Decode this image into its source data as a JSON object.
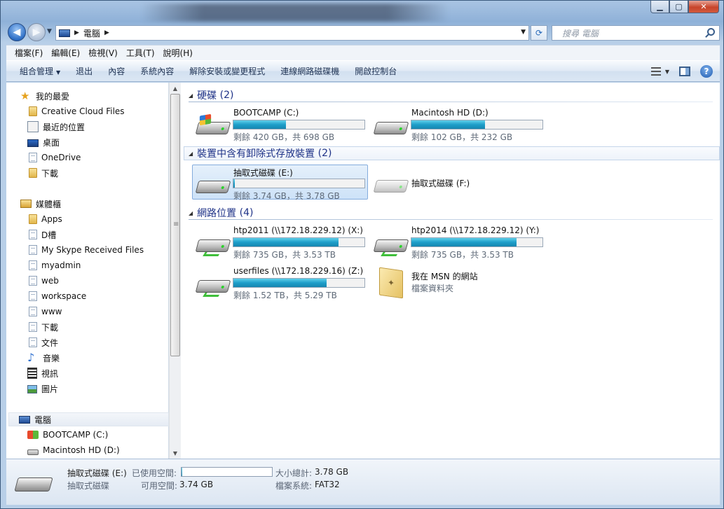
{
  "address": {
    "crumbs": [
      "電腦"
    ],
    "search_placeholder": "搜尋 電腦"
  },
  "menu": [
    "檔案(F)",
    "編輯(E)",
    "檢視(V)",
    "工具(T)",
    "說明(H)"
  ],
  "commands": [
    "組合管理",
    "退出",
    "內容",
    "系統內容",
    "解除安裝或變更程式",
    "連線網路磁碟機",
    "開啟控制台"
  ],
  "nav": {
    "favorites_header": "我的最愛",
    "favorites": [
      "Creative Cloud Files",
      "最近的位置",
      "桌面",
      "OneDrive",
      "下載"
    ],
    "libraries_header": "媒體櫃",
    "libraries": [
      "Apps",
      "D槽",
      "My Skype Received Files",
      "myadmin",
      "web",
      "workspace",
      "www",
      "下載",
      "文件",
      "音樂",
      "視訊",
      "圖片"
    ],
    "computer_header": "電腦",
    "computer": [
      "BOOTCAMP (C:)",
      "Macintosh HD (D:)"
    ]
  },
  "groups": {
    "hdd": {
      "title": "硬碟",
      "count": "(2)"
    },
    "removable": {
      "title": "裝置中含有卸除式存放裝置",
      "count": "(2)"
    },
    "network": {
      "title": "網路位置",
      "count": "(4)"
    }
  },
  "drives": {
    "c": {
      "name": "BOOTCAMP (C:)",
      "space": "剩餘 420 GB，共 698 GB",
      "used_fraction": 0.4
    },
    "d": {
      "name": "Macintosh HD (D:)",
      "space": "剩餘 102 GB，共 232 GB",
      "used_fraction": 0.56
    },
    "e": {
      "name": "抽取式磁碟 (E:)",
      "space": "剩餘 3.74 GB，共 3.78 GB",
      "used_fraction": 0.01
    },
    "f": {
      "name": "抽取式磁碟 (F:)"
    },
    "x": {
      "name": "htp2011 (\\\\172.18.229.12) (X:)",
      "space": "剩餘 735 GB，共 3.53 TB",
      "used_fraction": 0.8
    },
    "y": {
      "name": "htp2014 (\\\\172.18.229.12) (Y:)",
      "space": "剩餘 735 GB，共 3.53 TB",
      "used_fraction": 0.8
    },
    "z": {
      "name": "userfiles (\\\\172.18.229.16) (Z:)",
      "space": "剩餘 1.52 TB，共 5.29 TB",
      "used_fraction": 0.71
    },
    "msn": {
      "name": "我在 MSN 的網站",
      "type": "檔案資料夾"
    }
  },
  "details": {
    "name": "抽取式磁碟 (E:)",
    "type": "抽取式磁碟",
    "used_label": "已使用空間:",
    "free_label": "可用空間:",
    "free_value": "3.74 GB",
    "total_label": "大小總計:",
    "total_value": "3.78 GB",
    "fs_label": "檔案系統:",
    "fs_value": "FAT32",
    "used_fraction": 0.01
  }
}
